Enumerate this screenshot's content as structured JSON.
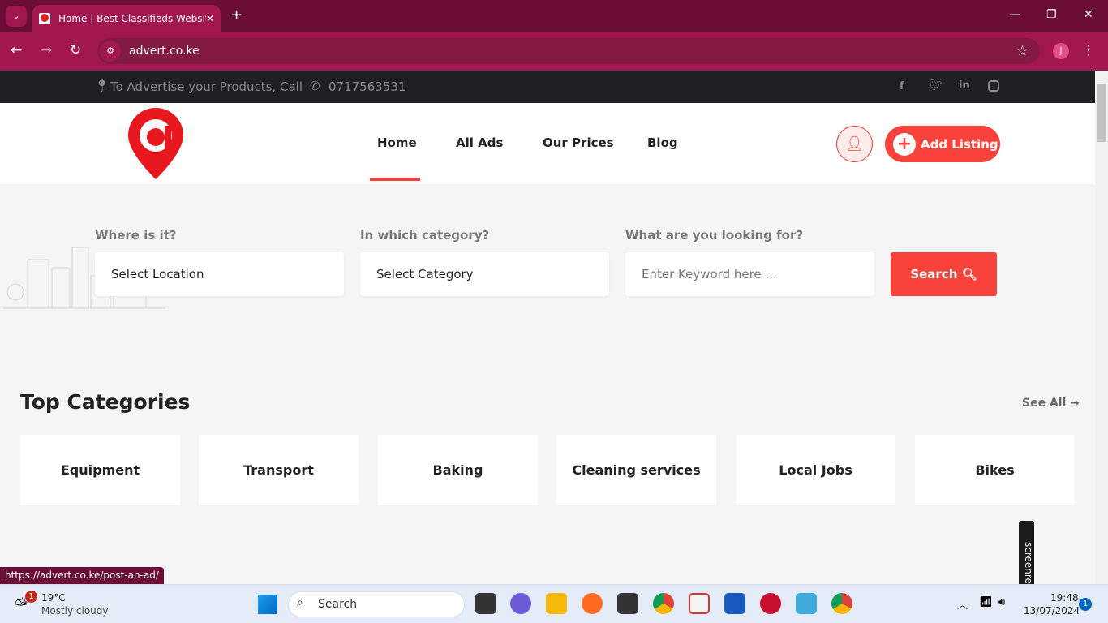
{
  "browser": {
    "tab_title": "Home | Best Classifieds Website",
    "url": "advert.co.ke",
    "profile_initial": "J",
    "status_url": "https://advert.co.ke/post-an-ad/"
  },
  "topbar": {
    "advertise_text": "To Advertise your Products, Call",
    "phone": "0717563531",
    "social": [
      "facebook-icon",
      "twitter-icon",
      "linkedin-icon",
      "instagram-icon"
    ]
  },
  "header": {
    "menu": [
      "Home",
      "All Ads",
      "Our Prices",
      "Blog"
    ],
    "active": "Home",
    "add_listing": "Add Listing"
  },
  "search": {
    "location_label": "Where is it?",
    "location_value": "Select Location",
    "category_label": "In which category?",
    "category_value": "Select Category",
    "keyword_label": "What are you looking for?",
    "keyword_placeholder": "Enter Keyword here ...",
    "button": "Search"
  },
  "categories": {
    "title": "Top Categories",
    "see_all": "See All",
    "items": [
      "Equipment",
      "Transport",
      "Baking",
      "Cleaning services",
      "Local Jobs",
      "Bikes"
    ]
  },
  "colors": {
    "accent": "#f9423a",
    "chrome": "#a2174f",
    "topbar": "#1e1f22"
  },
  "screenrec": "screenrec",
  "taskbar": {
    "weather_temp": "19°C",
    "weather_desc": "Mostly cloudy",
    "weather_badge": "1",
    "search": "Search",
    "time": "19:48",
    "date": "13/07/2024",
    "notifications": "1"
  }
}
